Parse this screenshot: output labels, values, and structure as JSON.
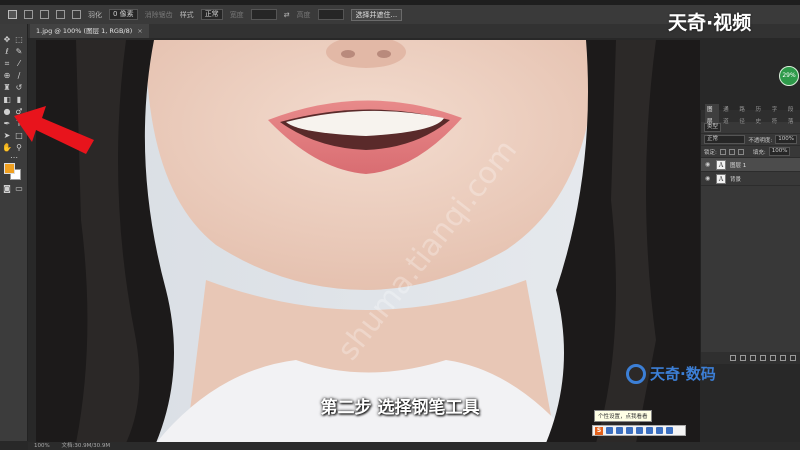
{
  "options_bar": {
    "feather_label": "羽化",
    "feather_value": "0 像素",
    "antialias_label": "消除锯齿",
    "style_label": "样式",
    "style_value": "正常",
    "width_label": "宽度",
    "height_label": "高度",
    "select_mask_button": "选择并遮住..."
  },
  "document_tab": {
    "title": "1.jpg @ 100% (图层 1, RGB/8)",
    "close": "×"
  },
  "toolbar": {
    "foreground_color": "#f0a020",
    "background_color": "#ffffff"
  },
  "layers_panel": {
    "tabs": [
      "图层",
      "通道",
      "路径",
      "历史",
      "字符",
      "段落"
    ],
    "active_tab": "图层",
    "filter_kind": "类型",
    "blend_mode": "正常",
    "opacity_label": "不透明度:",
    "opacity_value": "100%",
    "lock_label": "锁定:",
    "fill_label": "填充:",
    "fill_value": "100%",
    "layers": [
      {
        "name": "图层 1",
        "selected": true,
        "thumb": "A"
      },
      {
        "name": "背景",
        "selected": false,
        "thumb": "A"
      }
    ]
  },
  "status_bar": {
    "zoom": "100%",
    "doc_info": "文档:30.9M/30.9M"
  },
  "overlay": {
    "brand": "天奇·视频",
    "badge": "29%",
    "watermark_text": "shuma.tianqi.com",
    "watermark_logo": "天奇·数码",
    "subtitle": "第二步 选择钢笔工具",
    "tooltip": "个性设置，点我看看",
    "ime_label": "S"
  },
  "colors": {
    "arrow": "#e8141c",
    "accent_badge": "#2e9a4a"
  }
}
